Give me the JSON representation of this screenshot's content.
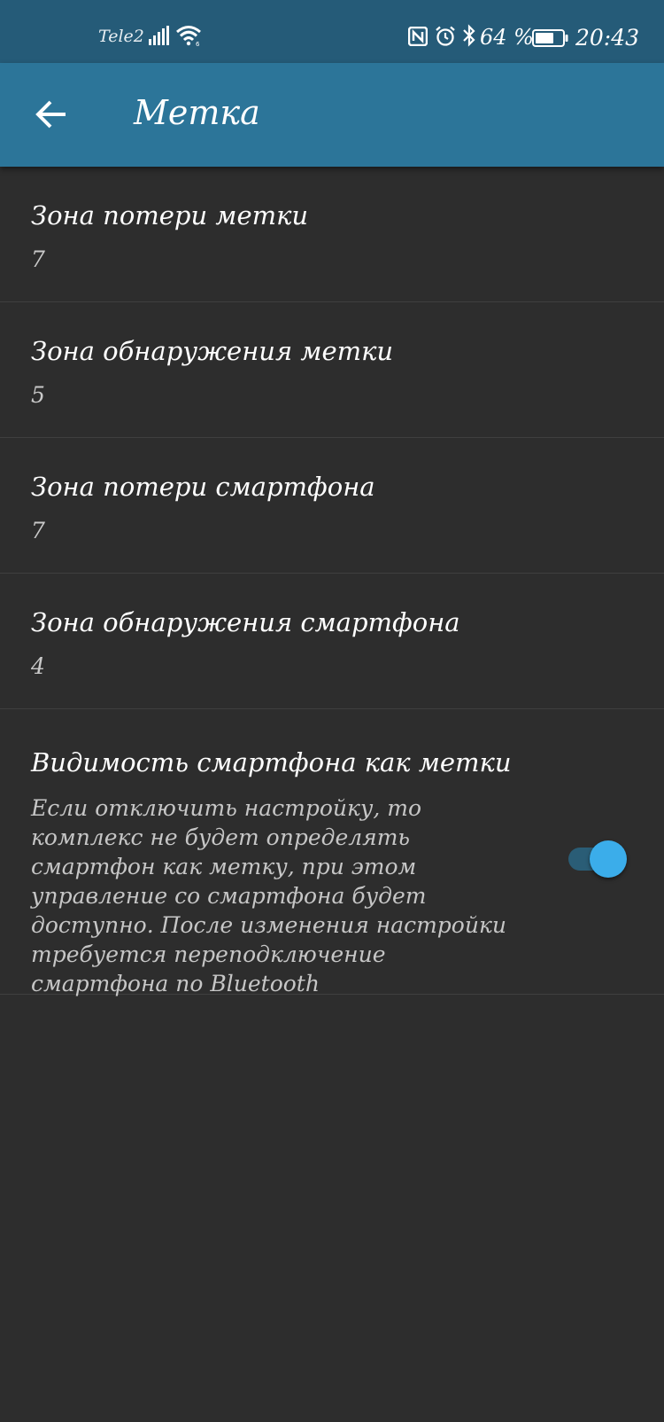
{
  "status_bar": {
    "carrier": "Tele2",
    "battery_percent": "64 %",
    "time": "20:43",
    "icons": [
      "signal-icon",
      "wifi-icon",
      "nfc-icon",
      "alarm-icon",
      "bluetooth-icon",
      "battery-icon"
    ]
  },
  "app_bar": {
    "back_icon": "arrow-left-icon",
    "title": "Метка"
  },
  "settings": [
    {
      "title": "Зона потери метки",
      "value": "7"
    },
    {
      "title": "Зона обнаружения метки",
      "value": "5"
    },
    {
      "title": "Зона потери смартфона",
      "value": "7"
    },
    {
      "title": "Зона обнаружения смартфона",
      "value": "4"
    }
  ],
  "visibility_setting": {
    "title": "Видимость смартфона как метки",
    "description": "Если отключить настройку, то комплекс не будет определять смартфон как метку, при этом управление со смартфона будет доступно. После изменения настройки требуется переподключение смартфона по Bluetooth",
    "enabled": true
  },
  "colors": {
    "status_bar": "#255b78",
    "app_bar": "#2c7599",
    "background": "#2d2d2d",
    "toggle_thumb": "#3badea",
    "toggle_track": "#2a5d76"
  }
}
